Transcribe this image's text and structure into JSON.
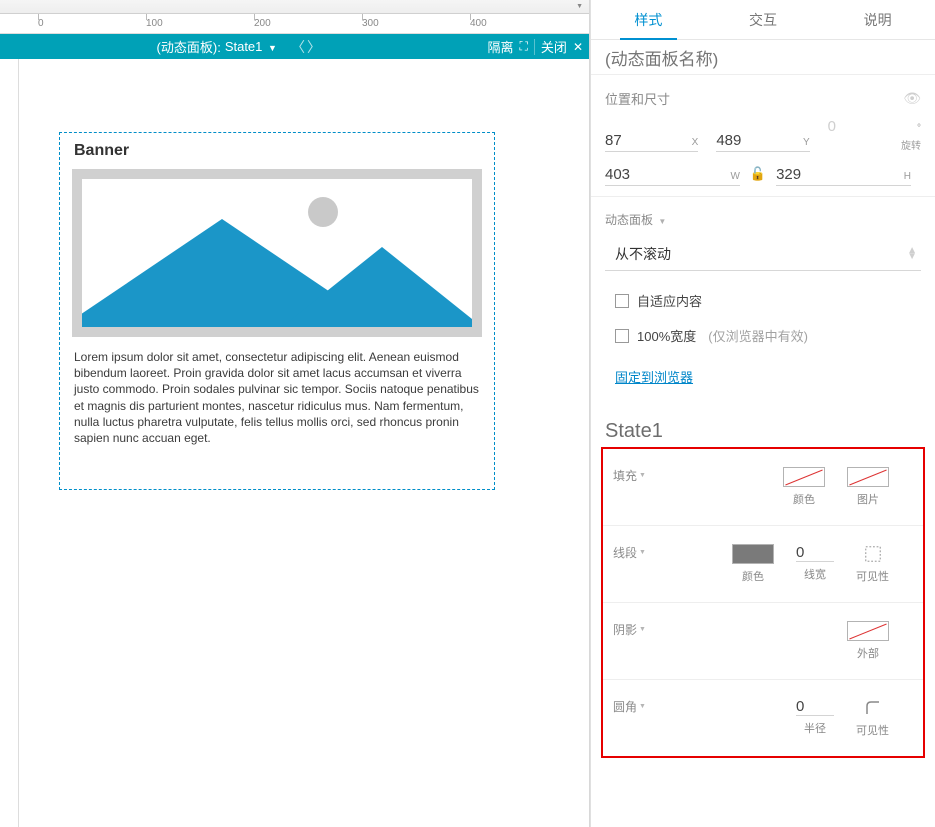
{
  "ruler": {
    "marks": [
      "0",
      "100",
      "200",
      "300",
      "400"
    ]
  },
  "tealbar": {
    "title_prefix": "(动态面板):",
    "state_label": "State1",
    "isolate": "隔离",
    "close": "关闭"
  },
  "canvas": {
    "banner_title": "Banner",
    "lorem": "Lorem ipsum dolor sit amet, consectetur adipiscing elit. Aenean euismod bibendum laoreet. Proin gravida dolor sit amet lacus accumsan et viverra justo commodo. Proin sodales pulvinar sic tempor. Sociis natoque penatibus et magnis dis parturient montes, nascetur ridiculus mus. Nam fermentum, nulla luctus pharetra vulputate, felis tellus mollis orci, sed rhoncus pronin sapien nunc accuan eget."
  },
  "tabs": {
    "style": "样式",
    "interact": "交互",
    "note": "说明"
  },
  "name_placeholder": "(动态面板名称)",
  "pos": {
    "title": "位置和尺寸",
    "x": "87",
    "y": "489",
    "w": "403",
    "h": "329",
    "rot": "0",
    "rot_label": "旋转",
    "X": "X",
    "Y": "Y",
    "W": "W",
    "H": "H",
    "deg": "°"
  },
  "dp": {
    "section_title": "动态面板",
    "select_value": "从不滚动",
    "fit_content": "自适应内容",
    "full_width": "100%宽度",
    "full_width_hint": "(仅浏览器中有效)",
    "pin": "固定到浏览器"
  },
  "state_section_title": "State1",
  "rows": {
    "fill": {
      "label": "填充",
      "color": "颜色",
      "image": "图片"
    },
    "line": {
      "label": "线段",
      "color": "颜色",
      "width": "线宽",
      "width_val": "0",
      "vis": "可见性"
    },
    "shadow": {
      "label": "阴影",
      "outer": "外部"
    },
    "radius": {
      "label": "圆角",
      "radius": "半径",
      "radius_val": "0",
      "vis": "可见性"
    }
  }
}
